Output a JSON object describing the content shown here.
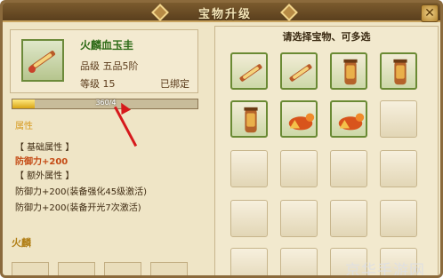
{
  "window": {
    "title": "宝物升级",
    "close_icon": "close-icon"
  },
  "item": {
    "name": "火麟血玉圭",
    "grade": "品级  五品5阶",
    "level": "等级  15",
    "bound": "已绑定",
    "icon": "jade-scepter-icon"
  },
  "exp": {
    "text": "360/4",
    "progress": 0.12
  },
  "attributes": {
    "title": "属性",
    "base_label": "【 基础属性 】",
    "base_value": "防御力+200",
    "extra_label": "【 额外属性 】",
    "extra_1": "防御力+200(装备强化45级激活)",
    "extra_2": "防御力+200(装备开光7次激活)"
  },
  "bottom_section": {
    "title": "火麟"
  },
  "picker": {
    "title": "请选择宝物、可多选",
    "slots": [
      {
        "icon": "jade-scepter-icon"
      },
      {
        "icon": "jade-scepter-icon"
      },
      {
        "icon": "bronze-vase-icon"
      },
      {
        "icon": "bronze-vase-icon"
      },
      {
        "icon": "bronze-vase-icon"
      },
      {
        "icon": "fire-qilin-icon"
      },
      {
        "icon": "fire-qilin-icon"
      }
    ]
  },
  "watermark": "京华手游网",
  "colors": {
    "accent": "#d6191c",
    "frame": "#8b6a3c",
    "item_name": "#2e6b17"
  }
}
